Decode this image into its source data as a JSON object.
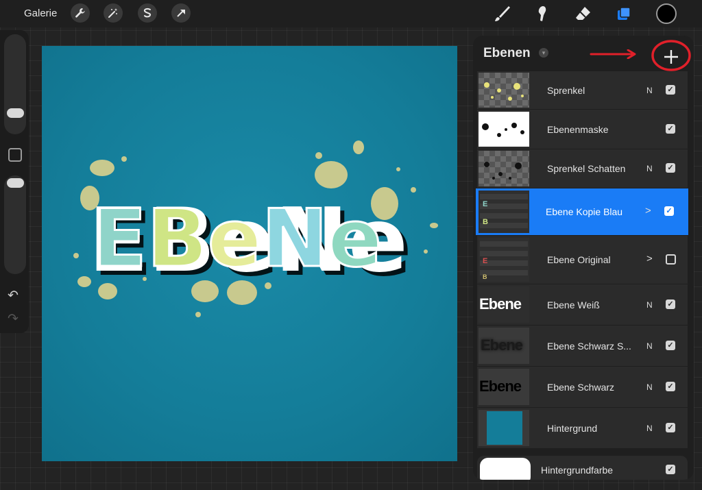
{
  "topbar": {
    "gallery_label": "Galerie",
    "left_tools": [
      "wrench-icon",
      "magic-wand-icon",
      "selection-icon",
      "transform-arrow-icon"
    ],
    "right_tools": [
      "brush-icon",
      "smudge-icon",
      "eraser-icon",
      "layers-icon"
    ],
    "active_tool": "layers-icon",
    "current_color": "#000000"
  },
  "sidebar": {
    "controls": [
      "brush-size-slider",
      "modify-button",
      "opacity-slider",
      "undo-icon",
      "redo-icon"
    ]
  },
  "canvas": {
    "artwork_text": "Ebene",
    "background_color": "#147d99",
    "splash_color": "#c8c98e"
  },
  "layers_panel": {
    "title": "Ebenen",
    "add_button_icon": "plus-icon",
    "annotation": "red-arrow-and-circle-highlighting-add-button",
    "accent_color": "#1a7cf6",
    "layers": [
      {
        "name": "Sprenkel",
        "blend": "N",
        "visible": true,
        "thumb": "yellow-splatter"
      },
      {
        "name": "Ebenenmaske",
        "blend": "",
        "visible": true,
        "thumb": "mask"
      },
      {
        "name": "Sprenkel Schatten",
        "blend": "N",
        "visible": true,
        "thumb": "black-splatter"
      },
      {
        "name": "Ebene Kopie Blau",
        "blend": ">",
        "visible": true,
        "selected": true,
        "thumb": "group"
      },
      {
        "name": "Ebene Original",
        "blend": ">",
        "visible": false,
        "thumb": "group"
      },
      {
        "name": "Ebene Weiß",
        "blend": "N",
        "visible": true,
        "thumb": "white-text",
        "thumb_text": "Ebene"
      },
      {
        "name": "Ebene Schwarz S...",
        "blend": "N",
        "visible": true,
        "thumb": "blurred-text",
        "thumb_text": "Ebene"
      },
      {
        "name": "Ebene Schwarz",
        "blend": "N",
        "visible": true,
        "thumb": "black-text",
        "thumb_text": "Ebene"
      },
      {
        "name": "Hintergrund",
        "blend": "N",
        "visible": true,
        "thumb": "blue-fill"
      },
      {
        "name": "Hintergrundfarbe",
        "blend": "",
        "visible": true,
        "thumb": "white-fill"
      }
    ]
  }
}
